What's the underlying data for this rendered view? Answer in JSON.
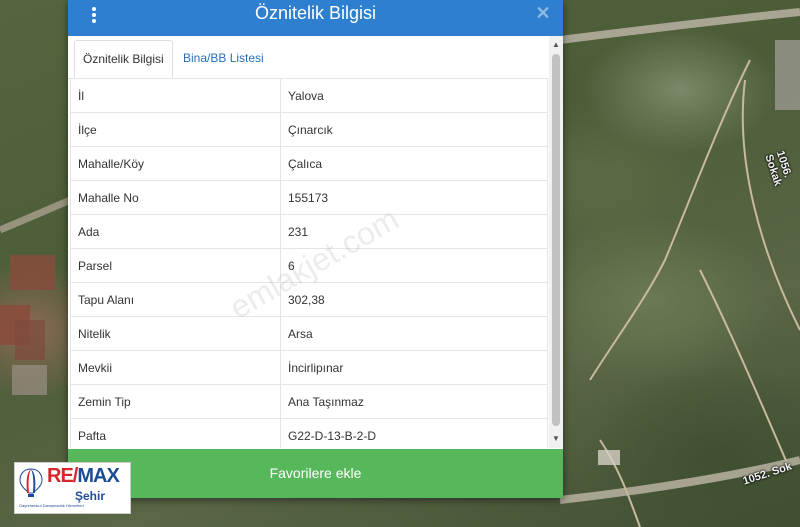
{
  "dialog": {
    "title": "Öznitelik Bilgisi",
    "close_icon": "close-icon",
    "menu_icon": "vertical-dots-icon"
  },
  "tabs": [
    {
      "label": "Öznitelik Bilgisi",
      "active": true
    },
    {
      "label": "Bina/BB Listesi",
      "active": false
    }
  ],
  "rows": [
    {
      "key": "İl",
      "value": "Yalova"
    },
    {
      "key": "İlçe",
      "value": "Çınarcık"
    },
    {
      "key": "Mahalle/Köy",
      "value": "Çalıca"
    },
    {
      "key": "Mahalle No",
      "value": "155173"
    },
    {
      "key": "Ada",
      "value": "231"
    },
    {
      "key": "Parsel",
      "value": "6"
    },
    {
      "key": "Tapu Alanı",
      "value": "302,38"
    },
    {
      "key": "Nitelik",
      "value": "Arsa"
    },
    {
      "key": "Mevkii",
      "value": "İncirlipınar"
    },
    {
      "key": "Zemin Tip",
      "value": "Ana Taşınmaz"
    },
    {
      "key": "Pafta",
      "value": "G22-D-13-B-2-D"
    }
  ],
  "favorite_button": "Favorilere ekle",
  "map": {
    "road_labels": [
      "1056. Sokak",
      "1052. Sok"
    ]
  },
  "logo": {
    "brand_re": "RE/",
    "brand_max": "MAX",
    "sub": "Şehir",
    "tagline": "Gayrimenkul Danışmanlık Hizmetleri"
  },
  "watermark": "emlakjet.com",
  "colors": {
    "header": "#2f7fd0",
    "button": "#56b85b",
    "tab_link": "#2a6fb6"
  }
}
